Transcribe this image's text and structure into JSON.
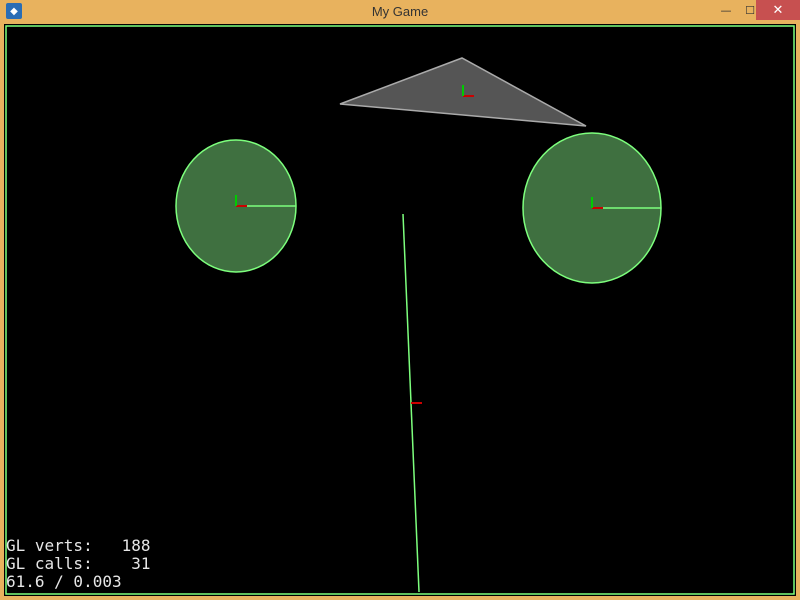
{
  "window": {
    "title": "My Game",
    "minimize_glyph": "—",
    "maximize_glyph": "☐",
    "close_glyph": "✕"
  },
  "colors": {
    "titlebar": "#e8b25e",
    "background": "#000000",
    "physics_outline": "#7dff7d",
    "circle_fill": "#3f7040",
    "triangle_fill": "#555555",
    "axis_x": "#cc0000",
    "axis_y": "#00cc00"
  },
  "stats": {
    "verts_label": "GL verts:",
    "verts_value": "188",
    "calls_label": "GL calls:",
    "calls_value": "31",
    "fps_line": "61.6 / 0.003"
  }
}
